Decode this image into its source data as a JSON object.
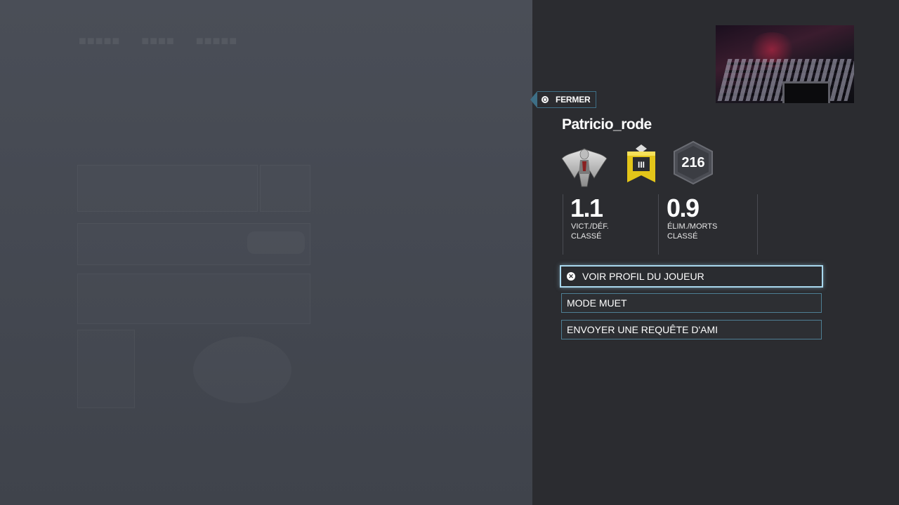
{
  "close_button": {
    "label": "FERMER"
  },
  "player": {
    "name": "Patricio_rode",
    "level": "216"
  },
  "stats": [
    {
      "value": "1.1",
      "label_line1": "VICT./DÉF.",
      "label_line2": "CLASSÉ"
    },
    {
      "value": "0.9",
      "label_line1": "ÉLIM./MORTS",
      "label_line2": "CLASSÉ"
    }
  ],
  "menu": {
    "view_profile": "VOIR PROFIL DU JOUEUR",
    "mute": "MODE MUET",
    "friend_request": "ENVOYER UNE REQUÊTE D'AMI"
  },
  "colors": {
    "accent": "#4e7f94",
    "highlight": "#a9d8ee",
    "alpha_pack": "#e3c519"
  }
}
